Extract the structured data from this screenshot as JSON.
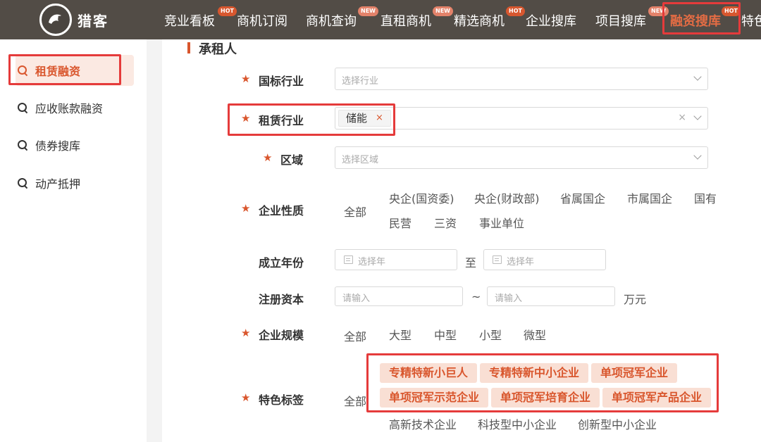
{
  "brand": {
    "name": "猎客"
  },
  "nav": {
    "items": [
      {
        "label": "竞业看板",
        "badge": "HOT"
      },
      {
        "label": "商机订阅",
        "badge": ""
      },
      {
        "label": "商机查询",
        "badge": "NEW"
      },
      {
        "label": "直租商机",
        "badge": "NEW"
      },
      {
        "label": "精选商机",
        "badge": "HOT"
      },
      {
        "label": "企业搜库",
        "badge": ""
      },
      {
        "label": "项目搜库",
        "badge": "NEW"
      },
      {
        "label": "融资搜库",
        "badge": "HOT"
      },
      {
        "label": "特色",
        "badge": ""
      }
    ],
    "active": "融资搜库"
  },
  "sidebar": {
    "items": [
      {
        "label": "租赁融资"
      },
      {
        "label": "应收账款融资"
      },
      {
        "label": "债券搜库"
      },
      {
        "label": "动产抵押"
      }
    ]
  },
  "section": {
    "title": "承租人"
  },
  "form": {
    "industry": {
      "label": "国标行业",
      "placeholder": "选择行业"
    },
    "lease_industry": {
      "label": "租赁行业",
      "tag": "储能",
      "tag_remove": "×",
      "clear": "×"
    },
    "region": {
      "label": "区域",
      "placeholder": "选择区域"
    },
    "nature": {
      "label": "企业性质",
      "all": "全部",
      "options": [
        "央企(国资委)",
        "央企(财政部)",
        "省属国企",
        "市属国企",
        "国有",
        "民营",
        "三资",
        "事业单位"
      ]
    },
    "founded": {
      "label": "成立年份",
      "start_placeholder": "选择年",
      "sep": "至",
      "end_placeholder": "选择年"
    },
    "capital": {
      "label": "注册资本",
      "min_placeholder": "请输入",
      "sep": "~",
      "max_placeholder": "请输入",
      "unit": "万元"
    },
    "scale": {
      "label": "企业规模",
      "all": "全部",
      "options": [
        "大型",
        "中型",
        "小型",
        "微型"
      ]
    },
    "tags": {
      "label": "特色标签",
      "all": "全部",
      "selected": [
        "专精特新小巨人",
        "专精特新中小企业",
        "单项冠军企业",
        "单项冠军示范企业",
        "单项冠军培育企业",
        "单项冠军产品企业"
      ],
      "options": [
        "高新技术企业",
        "科技型中小企业",
        "创新型中小企业"
      ]
    }
  },
  "colors": {
    "accent": "#d9562d",
    "highlight_box": "#e53b3b",
    "nav_bg": "#524c46"
  }
}
